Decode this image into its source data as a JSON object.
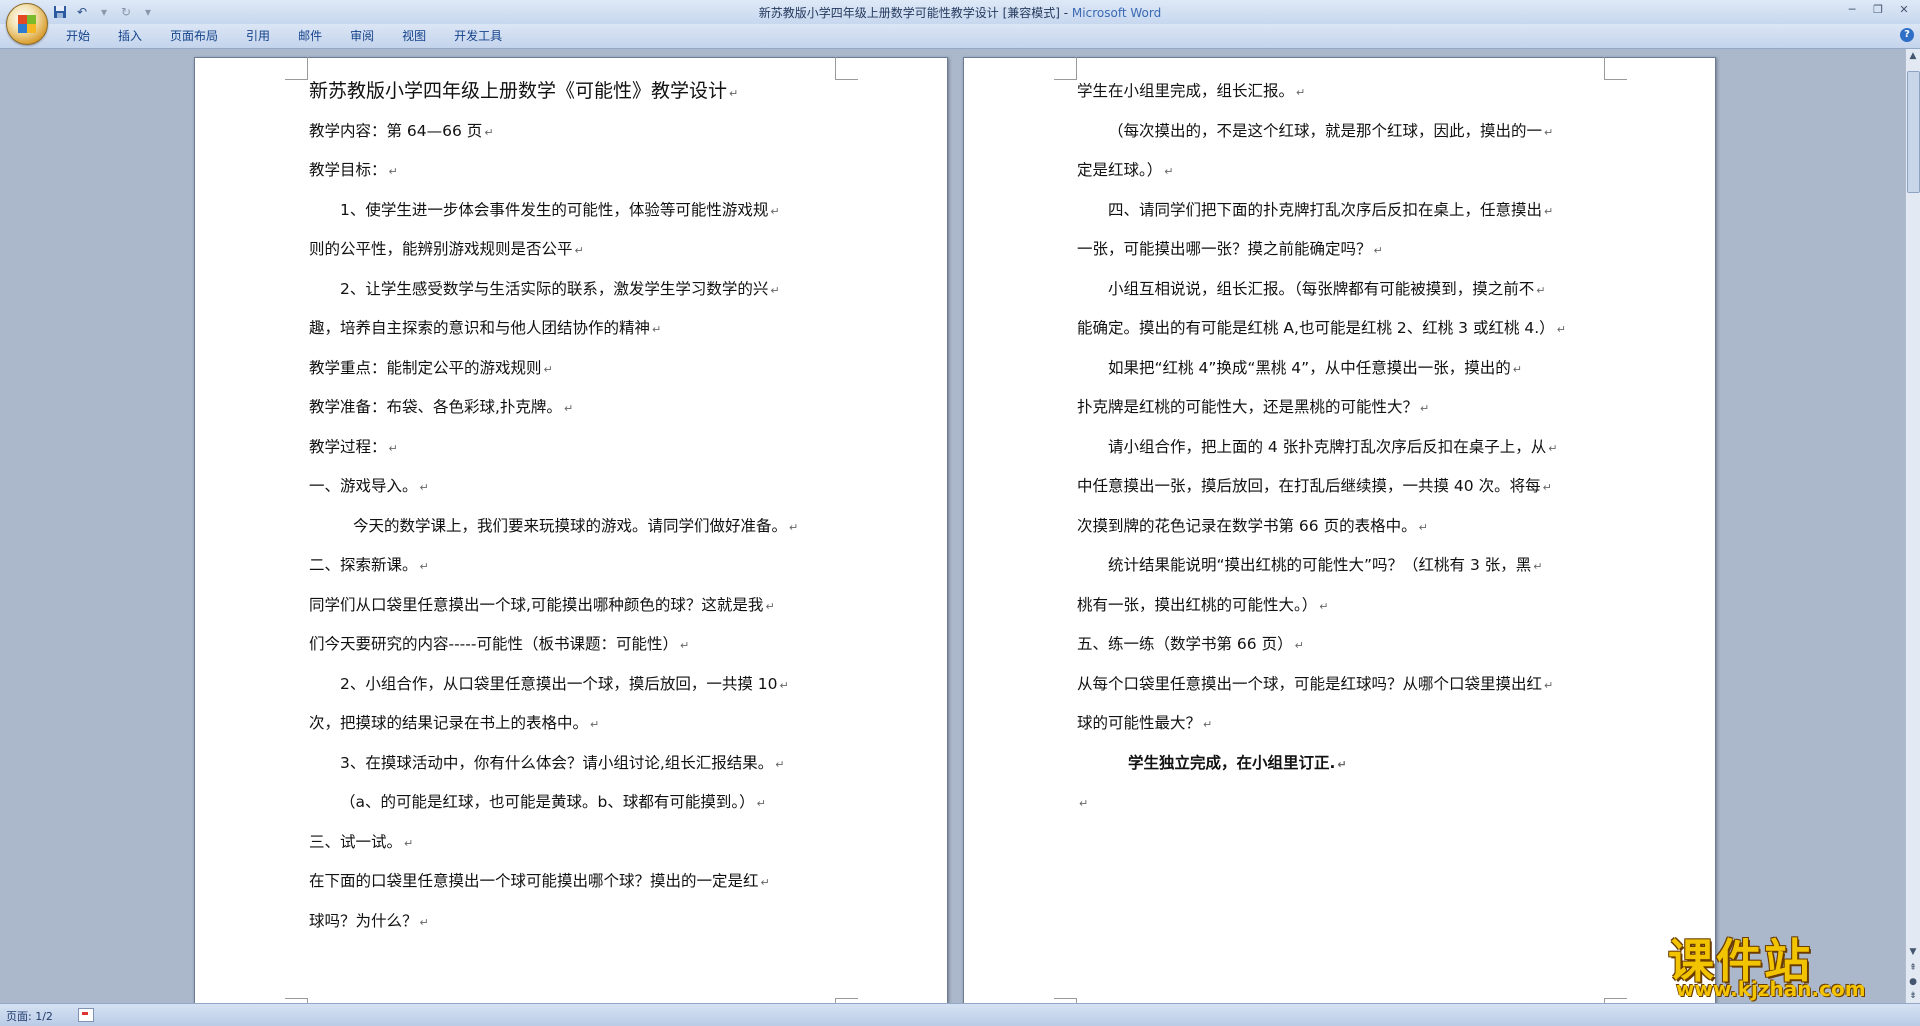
{
  "window": {
    "title_doc": "新苏教版小学四年级上册数学可能性教学设计 [兼容模式] - ",
    "title_app": "Microsoft Word"
  },
  "quick_access": {
    "save_icon": "save-icon",
    "undo_icon": "undo-icon",
    "redo_icon": "redo-icon",
    "customize_icon": "dropdown-icon"
  },
  "ribbon": {
    "tabs": [
      "开始",
      "插入",
      "页面布局",
      "引用",
      "邮件",
      "审阅",
      "视图",
      "开发工具"
    ]
  },
  "document": {
    "left_page": [
      {
        "text": "新苏教版小学四年级上册数学《可能性》教学设计",
        "style": "title"
      },
      {
        "text": "教学内容：第 64—66 页",
        "style": ""
      },
      {
        "text": "教学目标：",
        "style": ""
      },
      {
        "text": "1、使学生进一步体会事件发生的可能性，体验等可能性游戏规",
        "style": "ind1"
      },
      {
        "text": "则的公平性，能辨别游戏规则是否公平",
        "style": ""
      },
      {
        "text": "2、让学生感受数学与生活实际的联系，激发学生学习数学的兴",
        "style": "ind1"
      },
      {
        "text": "趣，培养自主探索的意识和与他人团结协作的精神",
        "style": ""
      },
      {
        "text": "教学重点：能制定公平的游戏规则",
        "style": ""
      },
      {
        "text": "教学准备：布袋、各色彩球,扑克牌。",
        "style": ""
      },
      {
        "text": "教学过程：",
        "style": ""
      },
      {
        "text": "一、游戏导入。",
        "style": ""
      },
      {
        "text": "今天的数学课上，我们要来玩摸球的游戏。请同学们做好准备。",
        "style": "ind2"
      },
      {
        "text": "二、探索新课。",
        "style": ""
      },
      {
        "text": "同学们从口袋里任意摸出一个球,可能摸出哪种颜色的球？这就是我",
        "style": ""
      },
      {
        "text": "们今天要研究的内容-----可能性（板书课题：可能性）",
        "style": ""
      },
      {
        "text": "2、小组合作，从口袋里任意摸出一个球，摸后放回，一共摸 10",
        "style": "ind1"
      },
      {
        "text": "次，把摸球的结果记录在书上的表格中。",
        "style": ""
      },
      {
        "text": "3、在摸球活动中，你有什么体会？请小组讨论,组长汇报结果。",
        "style": "ind1"
      },
      {
        "text": "（a、的可能是红球，也可能是黄球。b、球都有可能摸到。）",
        "style": "ind1"
      },
      {
        "text": "三、试一试。",
        "style": ""
      },
      {
        "text": "在下面的口袋里任意摸出一个球可能摸出哪个球？摸出的一定是红",
        "style": ""
      },
      {
        "text": "球吗？为什么？",
        "style": ""
      }
    ],
    "right_page": [
      {
        "text": "学生在小组里完成，组长汇报。",
        "style": ""
      },
      {
        "text": "（每次摸出的，不是这个红球，就是那个红球，因此，摸出的一",
        "style": "ind1"
      },
      {
        "text": "定是红球。）",
        "style": ""
      },
      {
        "text": "四、请同学们把下面的扑克牌打乱次序后反扣在桌上，任意摸出",
        "style": "ind1"
      },
      {
        "text": "一张，可能摸出哪一张？摸之前能确定吗？",
        "style": ""
      },
      {
        "text": "小组互相说说，组长汇报。（每张牌都有可能被摸到，摸之前不",
        "style": "ind1"
      },
      {
        "text": "能确定。摸出的有可能是红桃 A,也可能是红桃 2、红桃 3 或红桃 4.）",
        "style": ""
      },
      {
        "text": "如果把“红桃 4”换成“黑桃 4”，从中任意摸出一张，摸出的",
        "style": "ind1"
      },
      {
        "text": "扑克牌是红桃的可能性大，还是黑桃的可能性大？",
        "style": ""
      },
      {
        "text": "请小组合作，把上面的 4 张扑克牌打乱次序后反扣在桌子上，从",
        "style": "ind1"
      },
      {
        "text": "中任意摸出一张，摸后放回，在打乱后继续摸，一共摸 40 次。将每",
        "style": ""
      },
      {
        "text": "次摸到牌的花色记录在数学书第 66 页的表格中。",
        "style": ""
      },
      {
        "text": "统计结果能说明“摸出红桃的可能性大”吗？（红桃有 3 张，黑",
        "style": "ind1"
      },
      {
        "text": "桃有一张，摸出红桃的可能性大。）",
        "style": ""
      },
      {
        "text": "五、练一练（数学书第 66 页）",
        "style": ""
      },
      {
        "text": "从每个口袋里任意摸出一个球，可能是红球吗？从哪个口袋里摸出红",
        "style": ""
      },
      {
        "text": "球的可能性最大？",
        "style": ""
      },
      {
        "text": "学生独立完成，在小组里订正.",
        "style": "ind1b bold"
      },
      {
        "text": "",
        "style": ""
      }
    ]
  },
  "statusbar": {
    "page": "页面: 1/2"
  },
  "watermark": {
    "main": "课件站",
    "url": "www.kjzhan.com"
  }
}
